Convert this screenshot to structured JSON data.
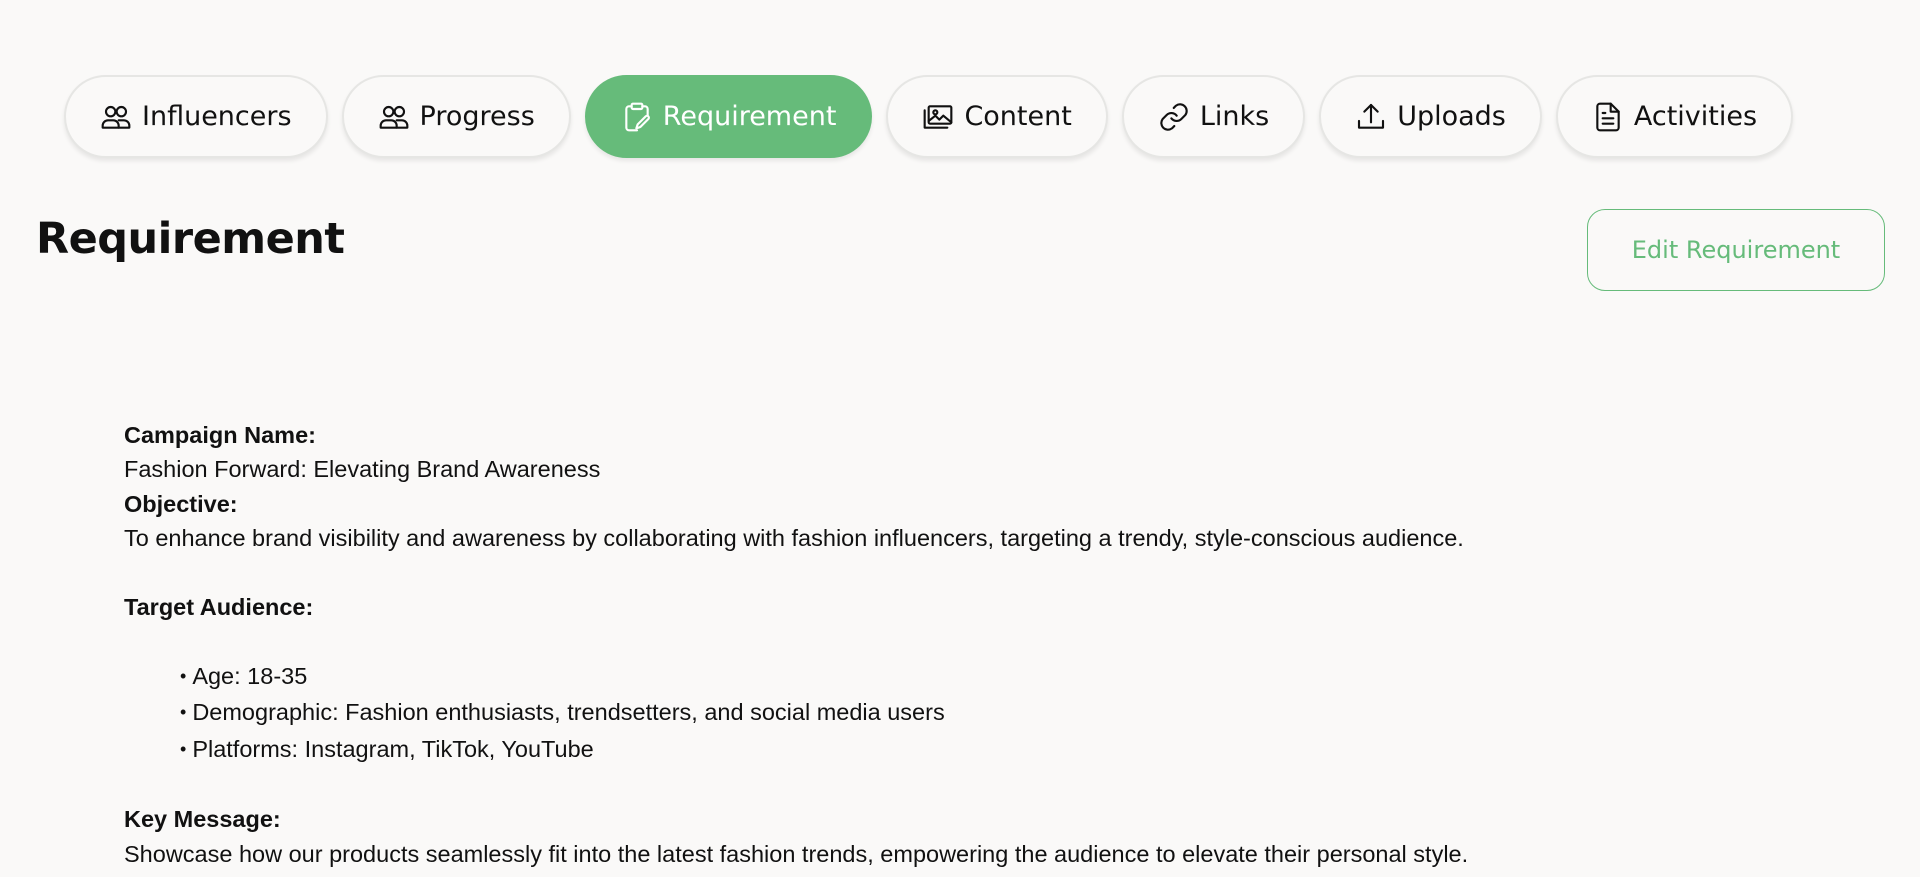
{
  "tabs": [
    {
      "label": "Influencers",
      "icon": "users-icon",
      "active": false
    },
    {
      "label": "Progress",
      "icon": "users-icon",
      "active": false
    },
    {
      "label": "Requirement",
      "icon": "clipboard-edit-icon",
      "active": true
    },
    {
      "label": "Content",
      "icon": "images-icon",
      "active": false
    },
    {
      "label": "Links",
      "icon": "link-icon",
      "active": false
    },
    {
      "label": "Uploads",
      "icon": "upload-icon",
      "active": false
    },
    {
      "label": "Activities",
      "icon": "document-icon",
      "active": false
    }
  ],
  "header": {
    "title": "Requirement",
    "edit_label": "Edit Requirement"
  },
  "requirement": {
    "campaign_label": "Campaign Name:",
    "campaign_value": "Fashion Forward: Elevating Brand Awareness",
    "objective_label": "Objective:",
    "objective_value": "To enhance brand visibility and awareness by collaborating with fashion influencers, targeting a trendy, style-conscious audience.",
    "audience_label": "Target Audience:",
    "audience_items": [
      "Age: 18-35",
      "Demographic: Fashion enthusiasts, trendsetters, and social media users",
      "Platforms: Instagram, TikTok, YouTube"
    ],
    "key_message_label": "Key Message:",
    "key_message_value": "Showcase how our products seamlessly fit into the latest fashion trends, empowering the audience to elevate their personal style."
  },
  "colors": {
    "accent": "#66bb7a",
    "background": "#faf9f8"
  }
}
